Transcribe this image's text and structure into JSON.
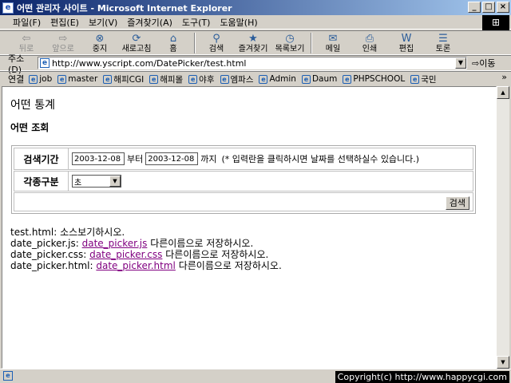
{
  "window": {
    "title": "어떤 관리자 사이트 - Microsoft Internet Explorer",
    "buttons": {
      "minimize": "_",
      "maximize": "□",
      "close": "×"
    }
  },
  "menu": [
    "파일(F)",
    "편집(E)",
    "보기(V)",
    "즐겨찾기(A)",
    "도구(T)",
    "도움말(H)"
  ],
  "toolbar": {
    "back": "뒤로",
    "forward": "앞으로",
    "stop": "중지",
    "refresh": "새로고침",
    "home": "홈",
    "search": "검색",
    "favorites": "즐겨찾기",
    "history": "목록보기",
    "mail": "메일",
    "print": "인쇄",
    "edit": "편집",
    "discuss": "토론"
  },
  "address": {
    "label": "주소(D)",
    "url": "http://www.yscript.com/DatePicker/test.html",
    "go": "이동"
  },
  "links": {
    "label": "연결",
    "items": [
      "job",
      "master",
      "해피CGI",
      "해피몰",
      "야후",
      "엠파스",
      "Admin",
      "Daum",
      "PHPSCHOOL",
      "국민"
    ]
  },
  "page": {
    "title": "어떤 통계",
    "section": "어떤 조회",
    "form": {
      "period_label": "검색기간",
      "start_date": "2003-12-08",
      "from_word": "부터",
      "end_date": "2003-12-08",
      "to_word": "까지",
      "hint": "(* 입력란을 클릭하시면 날짜를 선택하실수 있습니다.)",
      "type_label": "각종구분",
      "type_value": "초",
      "search_button": "검색"
    },
    "files": [
      {
        "name": "test.html:",
        "link": "",
        "note": "소스보기하시오."
      },
      {
        "name": "date_picker.js:",
        "link": "date_picker.js",
        "note": "다른이름으로 저장하시오."
      },
      {
        "name": "date_picker.css:",
        "link": "date_picker.css",
        "note": "다른이름으로 저장하시오."
      },
      {
        "name": "date_picker.html:",
        "link": "date_picker.html",
        "note": "다른이름으로 저장하시오."
      }
    ]
  },
  "status": {
    "copyright": "Copyright(c) http://www.happycgi.com"
  }
}
